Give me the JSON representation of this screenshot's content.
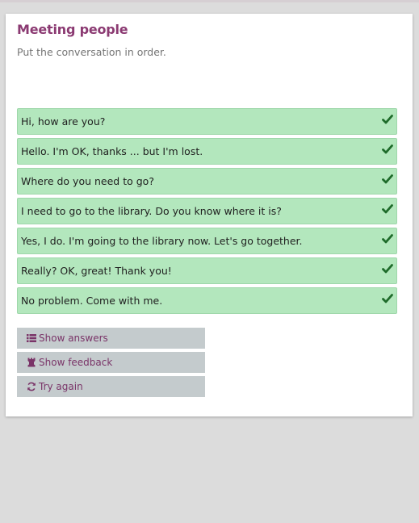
{
  "activity": {
    "title": "Meeting people",
    "instructions": "Put the conversation in order."
  },
  "conversation": {
    "items": [
      {
        "label": "Hi, how are you?",
        "status": "correct"
      },
      {
        "label": "Hello. I'm OK, thanks ... but I'm lost.",
        "status": "correct"
      },
      {
        "label": "Where do you need to go?",
        "status": "correct"
      },
      {
        "label": "I need to go to the library. Do you know where it is?",
        "status": "correct"
      },
      {
        "label": "Yes, I do. I'm going to the library now. Let's go together.",
        "status": "correct"
      },
      {
        "label": "Really? OK, great! Thank you!",
        "status": "correct"
      },
      {
        "label": "No problem. Come with me.",
        "status": "correct"
      }
    ]
  },
  "actions": {
    "show_answers": {
      "label": "Show answers",
      "icon": "list-icon"
    },
    "show_feedback": {
      "label": "Show feedback",
      "icon": "rook-icon"
    },
    "try_again": {
      "label": "Try again",
      "icon": "refresh-icon"
    }
  },
  "colors": {
    "title": "#8b3a72",
    "item_background": "#b3e7bd",
    "check": "#1e6b2a",
    "button_background": "#c4cbcd",
    "button_text": "#7a3468"
  }
}
